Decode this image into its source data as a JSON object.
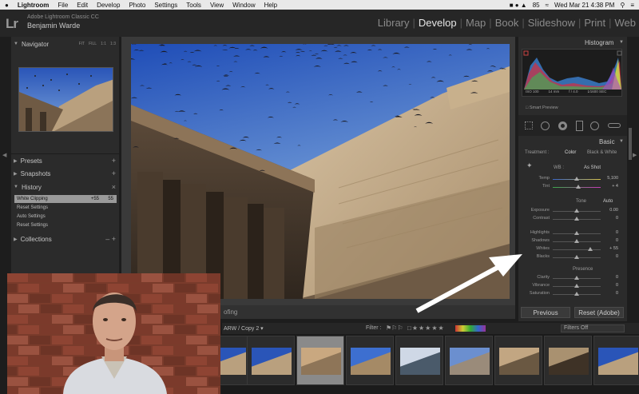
{
  "menubar": {
    "app": "Lightroom",
    "items": [
      "File",
      "Edit",
      "Develop",
      "Photo",
      "Settings",
      "Tools",
      "View",
      "Window",
      "Help"
    ],
    "battery": "85",
    "clock": "Wed Mar 21  4:38 PM"
  },
  "header": {
    "logo": "Lr",
    "app_name": "Adobe Lightroom Classic CC",
    "user": "Benjamin Warde",
    "modules": [
      {
        "label": "Library"
      },
      {
        "label": "Develop",
        "active": true
      },
      {
        "label": "Map"
      },
      {
        "label": "Book"
      },
      {
        "label": "Slideshow"
      },
      {
        "label": "Print"
      },
      {
        "label": "Web"
      }
    ]
  },
  "left_panel": {
    "navigator": "Navigator",
    "nav_options": [
      "FIT",
      "FILL",
      "1:1",
      "1:3"
    ],
    "presets": "Presets",
    "snapshots": "Snapshots",
    "history": "History",
    "history_items": [
      {
        "label": "White Clipping",
        "v1": "+55",
        "v2": "55",
        "selected": true
      },
      {
        "label": "Reset Settings"
      },
      {
        "label": "Auto Settings"
      },
      {
        "label": "Reset Settings"
      }
    ],
    "collections": "Collections"
  },
  "toolbar": {
    "proofing": "ofing"
  },
  "right_panel": {
    "histogram": "Histogram",
    "exif": [
      "ISO 100",
      "14 mm",
      "f / 4.0",
      "1⁄1600 SEC"
    ],
    "smart_preview": "Smart Preview",
    "basic": "Basic",
    "treatment_label": "Treatment :",
    "treatment_color": "Color",
    "treatment_bw": "Black & White",
    "wb_label": "WB :",
    "wb_value": "As Shot",
    "temp": {
      "label": "Temp",
      "value": "5,100"
    },
    "tint": {
      "label": "Tint",
      "value": "+ 4"
    },
    "tone": "Tone",
    "auto": "Auto",
    "tone_sliders": [
      {
        "label": "Exposure",
        "value": "0.00"
      },
      {
        "label": "Contrast",
        "value": "0"
      },
      {
        "label": "Highlights",
        "value": "0"
      },
      {
        "label": "Shadows",
        "value": "0"
      },
      {
        "label": "Whites",
        "value": "+ 55"
      },
      {
        "label": "Blacks",
        "value": "0"
      }
    ],
    "presence": "Presence",
    "presence_sliders": [
      {
        "label": "Clarity",
        "value": "0"
      },
      {
        "label": "Vibrance",
        "value": "0"
      },
      {
        "label": "Saturation",
        "value": "0"
      }
    ],
    "previous": "Previous",
    "reset": "Reset (Adobe)"
  },
  "filmstrip": {
    "path": "ARW / Copy 2 ▾",
    "filter_label": "Filter :",
    "filters_off": "Filters Off",
    "thumb_count": 8
  },
  "colors": {
    "accent": "#e6e6e6",
    "panel": "#2b2b2b",
    "selected_history": "#9a9a9a"
  }
}
